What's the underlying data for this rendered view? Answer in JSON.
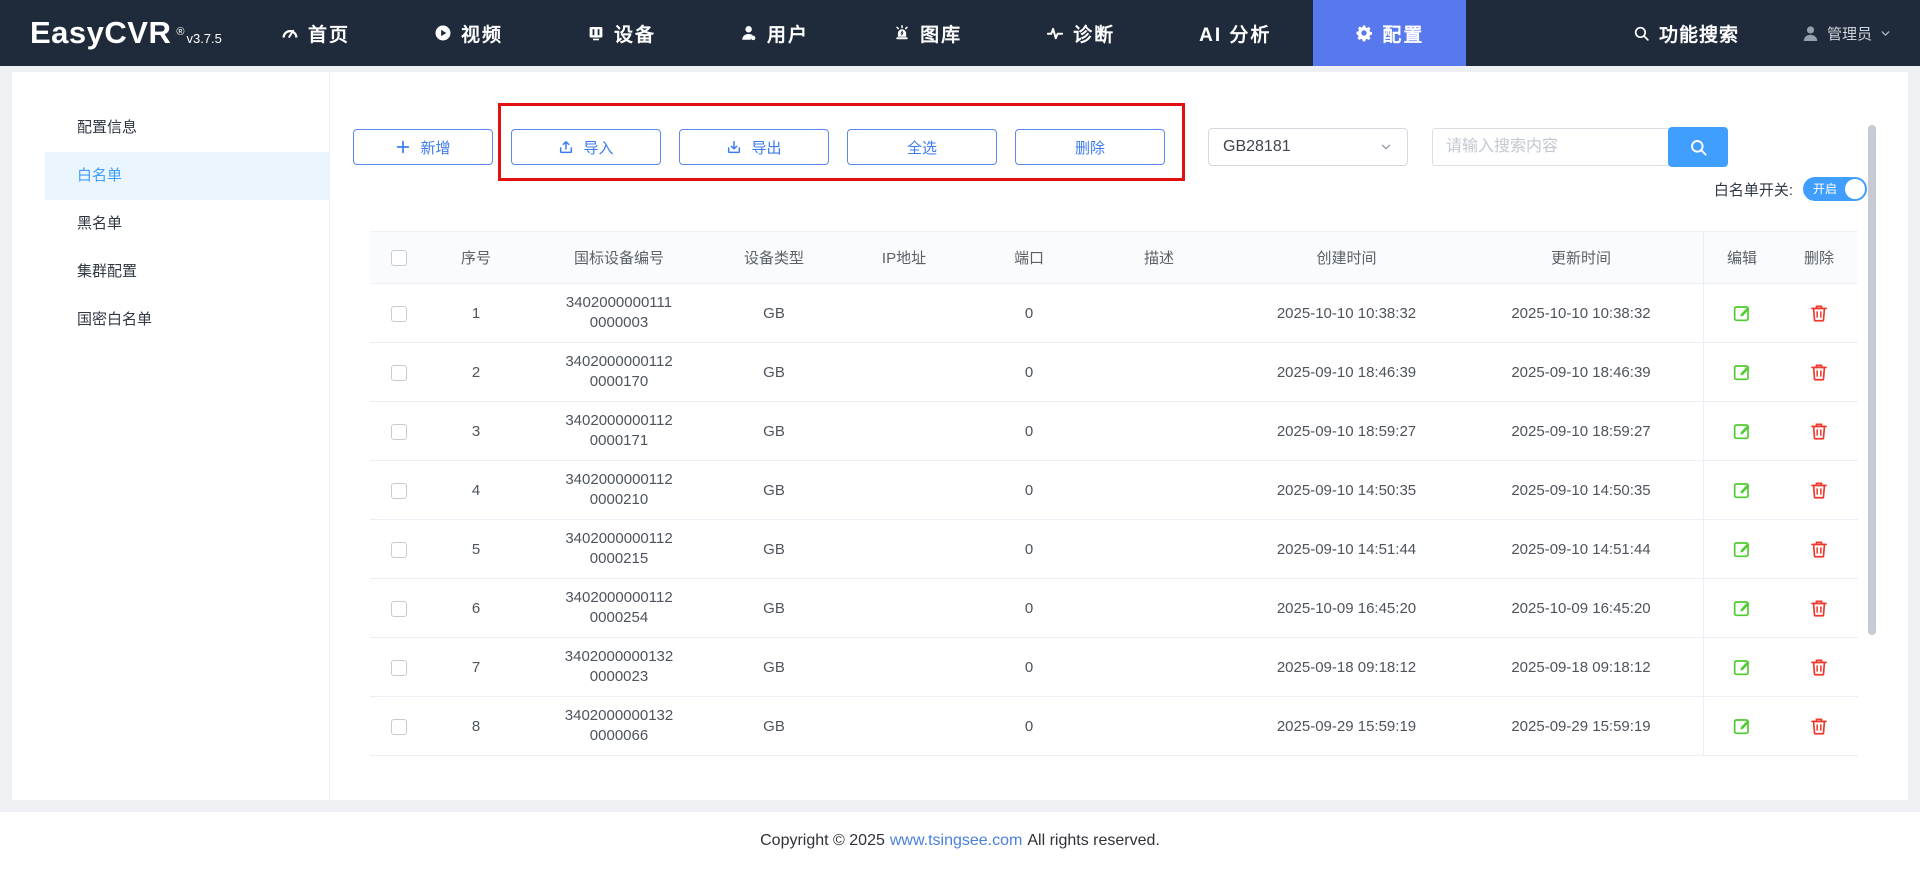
{
  "colors": {
    "primary": "#409eff",
    "nav-bg": "#1f2b3b",
    "nav-active": "#5878ee",
    "btn-border": "#5a87f0",
    "btn-text": "#3c7bf0",
    "annotation": "#e21010",
    "edit-green": "#4ecb2d",
    "delete-red": "#f0382c",
    "link-blue": "#4a7fe0"
  },
  "navbar": {
    "logo": "EasyCVR",
    "registered_mark": "®",
    "version": "v3.7.5",
    "items": [
      {
        "name": "nav-home",
        "icon": "dashboard-icon",
        "label": "首页",
        "active": false
      },
      {
        "name": "nav-video",
        "icon": "video-icon",
        "label": "视频",
        "active": false
      },
      {
        "name": "nav-device",
        "icon": "device-icon",
        "label": "设备",
        "active": false
      },
      {
        "name": "nav-users",
        "icon": "users-icon",
        "label": "用户",
        "active": false
      },
      {
        "name": "nav-gallery",
        "icon": "gallery-icon",
        "label": "图库",
        "active": false
      },
      {
        "name": "nav-diagnosis",
        "icon": "diagnosis-icon",
        "label": "诊断",
        "active": false
      },
      {
        "name": "nav-ai",
        "icon": null,
        "label": "AI 分析",
        "active": false
      },
      {
        "name": "nav-config",
        "icon": "gear-icon",
        "label": "配置",
        "active": true
      }
    ],
    "func_search_label": "功能搜索",
    "user_label": "管理员"
  },
  "sidebar": {
    "items": [
      {
        "name": "sidebar-item-config-info",
        "label": "配置信息",
        "active": false
      },
      {
        "name": "sidebar-item-whitelist",
        "label": "白名单",
        "active": true
      },
      {
        "name": "sidebar-item-blacklist",
        "label": "黑名单",
        "active": false
      },
      {
        "name": "sidebar-item-cluster",
        "label": "集群配置",
        "active": false
      },
      {
        "name": "sidebar-item-gm-whitelist",
        "label": "国密白名单",
        "active": false
      }
    ]
  },
  "toolbar": {
    "add_label": "新增",
    "import_label": "导入",
    "export_label": "导出",
    "select_all_label": "全选",
    "delete_label": "删除",
    "protocol_select_value": "GB28181",
    "search_placeholder": "请输入搜索内容",
    "whitelist_switch_label": "白名单开关:",
    "whitelist_switch_state": "开启"
  },
  "table": {
    "headers": [
      "序号",
      "国标设备编号",
      "设备类型",
      "IP地址",
      "端口",
      "描述",
      "创建时间",
      "更新时间",
      "编辑",
      "删除"
    ],
    "rows": [
      {
        "no": "1",
        "device_id": [
          "3402000000111",
          "0000003"
        ],
        "type": "GB",
        "ip": "",
        "port": "0",
        "desc": "",
        "created": "2025-10-10 10:38:32",
        "updated": "2025-10-10 10:38:32"
      },
      {
        "no": "2",
        "device_id": [
          "3402000000112",
          "0000170"
        ],
        "type": "GB",
        "ip": "",
        "port": "0",
        "desc": "",
        "created": "2025-09-10 18:46:39",
        "updated": "2025-09-10 18:46:39"
      },
      {
        "no": "3",
        "device_id": [
          "3402000000112",
          "0000171"
        ],
        "type": "GB",
        "ip": "",
        "port": "0",
        "desc": "",
        "created": "2025-09-10 18:59:27",
        "updated": "2025-09-10 18:59:27"
      },
      {
        "no": "4",
        "device_id": [
          "3402000000112",
          "0000210"
        ],
        "type": "GB",
        "ip": "",
        "port": "0",
        "desc": "",
        "created": "2025-09-10 14:50:35",
        "updated": "2025-09-10 14:50:35"
      },
      {
        "no": "5",
        "device_id": [
          "3402000000112",
          "0000215"
        ],
        "type": "GB",
        "ip": "",
        "port": "0",
        "desc": "",
        "created": "2025-09-10 14:51:44",
        "updated": "2025-09-10 14:51:44"
      },
      {
        "no": "6",
        "device_id": [
          "3402000000112",
          "0000254"
        ],
        "type": "GB",
        "ip": "",
        "port": "0",
        "desc": "",
        "created": "2025-10-09 16:45:20",
        "updated": "2025-10-09 16:45:20"
      },
      {
        "no": "7",
        "device_id": [
          "3402000000132",
          "0000023"
        ],
        "type": "GB",
        "ip": "",
        "port": "0",
        "desc": "",
        "created": "2025-09-18 09:18:12",
        "updated": "2025-09-18 09:18:12"
      },
      {
        "no": "8",
        "device_id": [
          "3402000000132",
          "0000066"
        ],
        "type": "GB",
        "ip": "",
        "port": "0",
        "desc": "",
        "created": "2025-09-29 15:59:19",
        "updated": "2025-09-29 15:59:19"
      }
    ]
  },
  "footer": {
    "copyright_prefix": "Copyright © 2025",
    "link_text": "www.tsingsee.com",
    "copyright_suffix": "All rights reserved."
  }
}
